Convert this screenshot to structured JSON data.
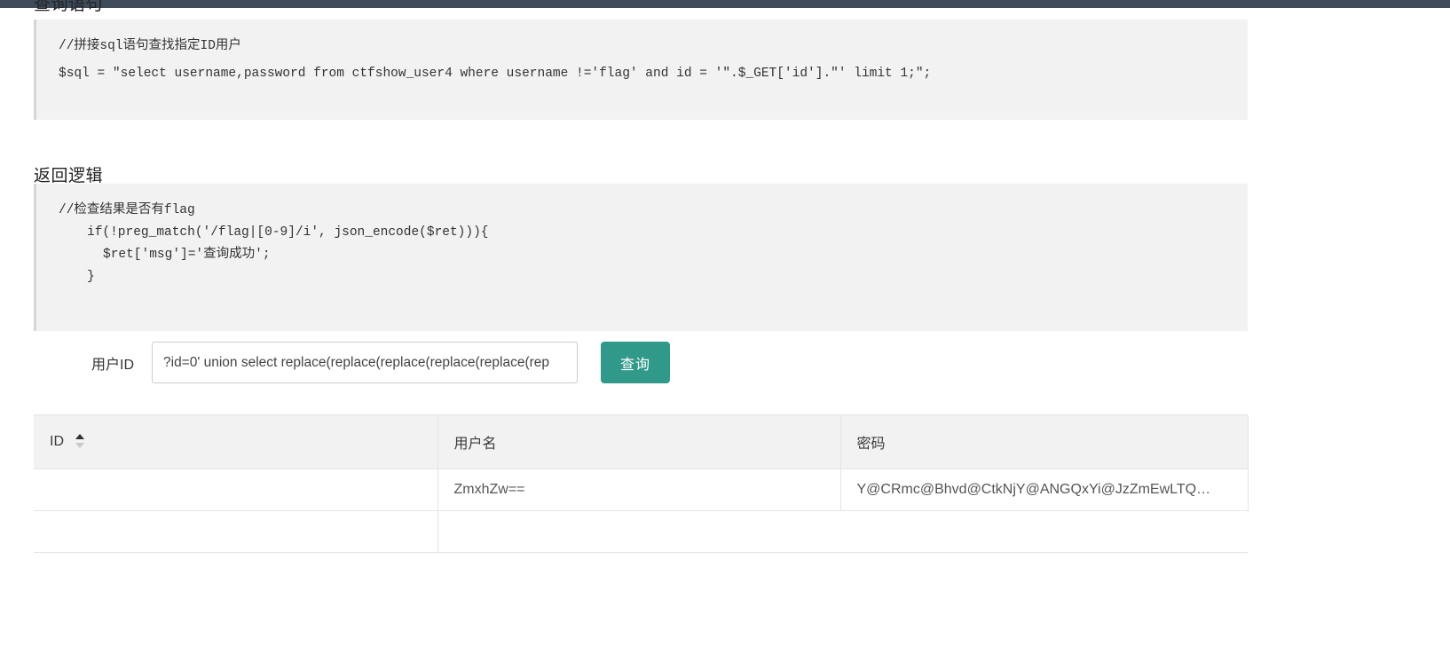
{
  "sections": {
    "query": {
      "title": "查询语句",
      "code": [
        "//拼接sql语句查找指定ID用户",
        "$sql = \"select username,password from ctfshow_user4 where username !='flag' and id = '\".$_GET['id'].\"' limit 1;\";"
      ]
    },
    "logic": {
      "title": "返回逻辑",
      "code": [
        "//检查结果是否有flag",
        "if(!preg_match('/flag|[0-9]/i', json_encode($ret))){",
        "$ret['msg']='查询成功';",
        "}"
      ]
    }
  },
  "form": {
    "label": "用户ID",
    "input_value": "?id=0' union select replace(replace(replace(replace(replace(rep",
    "input_placeholder": "",
    "submit_label": "查询"
  },
  "table": {
    "headers": [
      "ID",
      "用户名",
      "密码"
    ],
    "sort_icon": "sort-arrows-icon",
    "rows": [
      {
        "id": "",
        "username": "ZmxhZw==",
        "password": "Y@CRmc@Bhvd@CtkNjY@ANGQxYi@JzZmEwLTQ…"
      }
    ]
  },
  "colors": {
    "navbar": "#3f4a5a",
    "accent_button": "#31998a",
    "code_panel_bg": "#f2f2f2",
    "table_header_bg": "#f2f2f2"
  }
}
